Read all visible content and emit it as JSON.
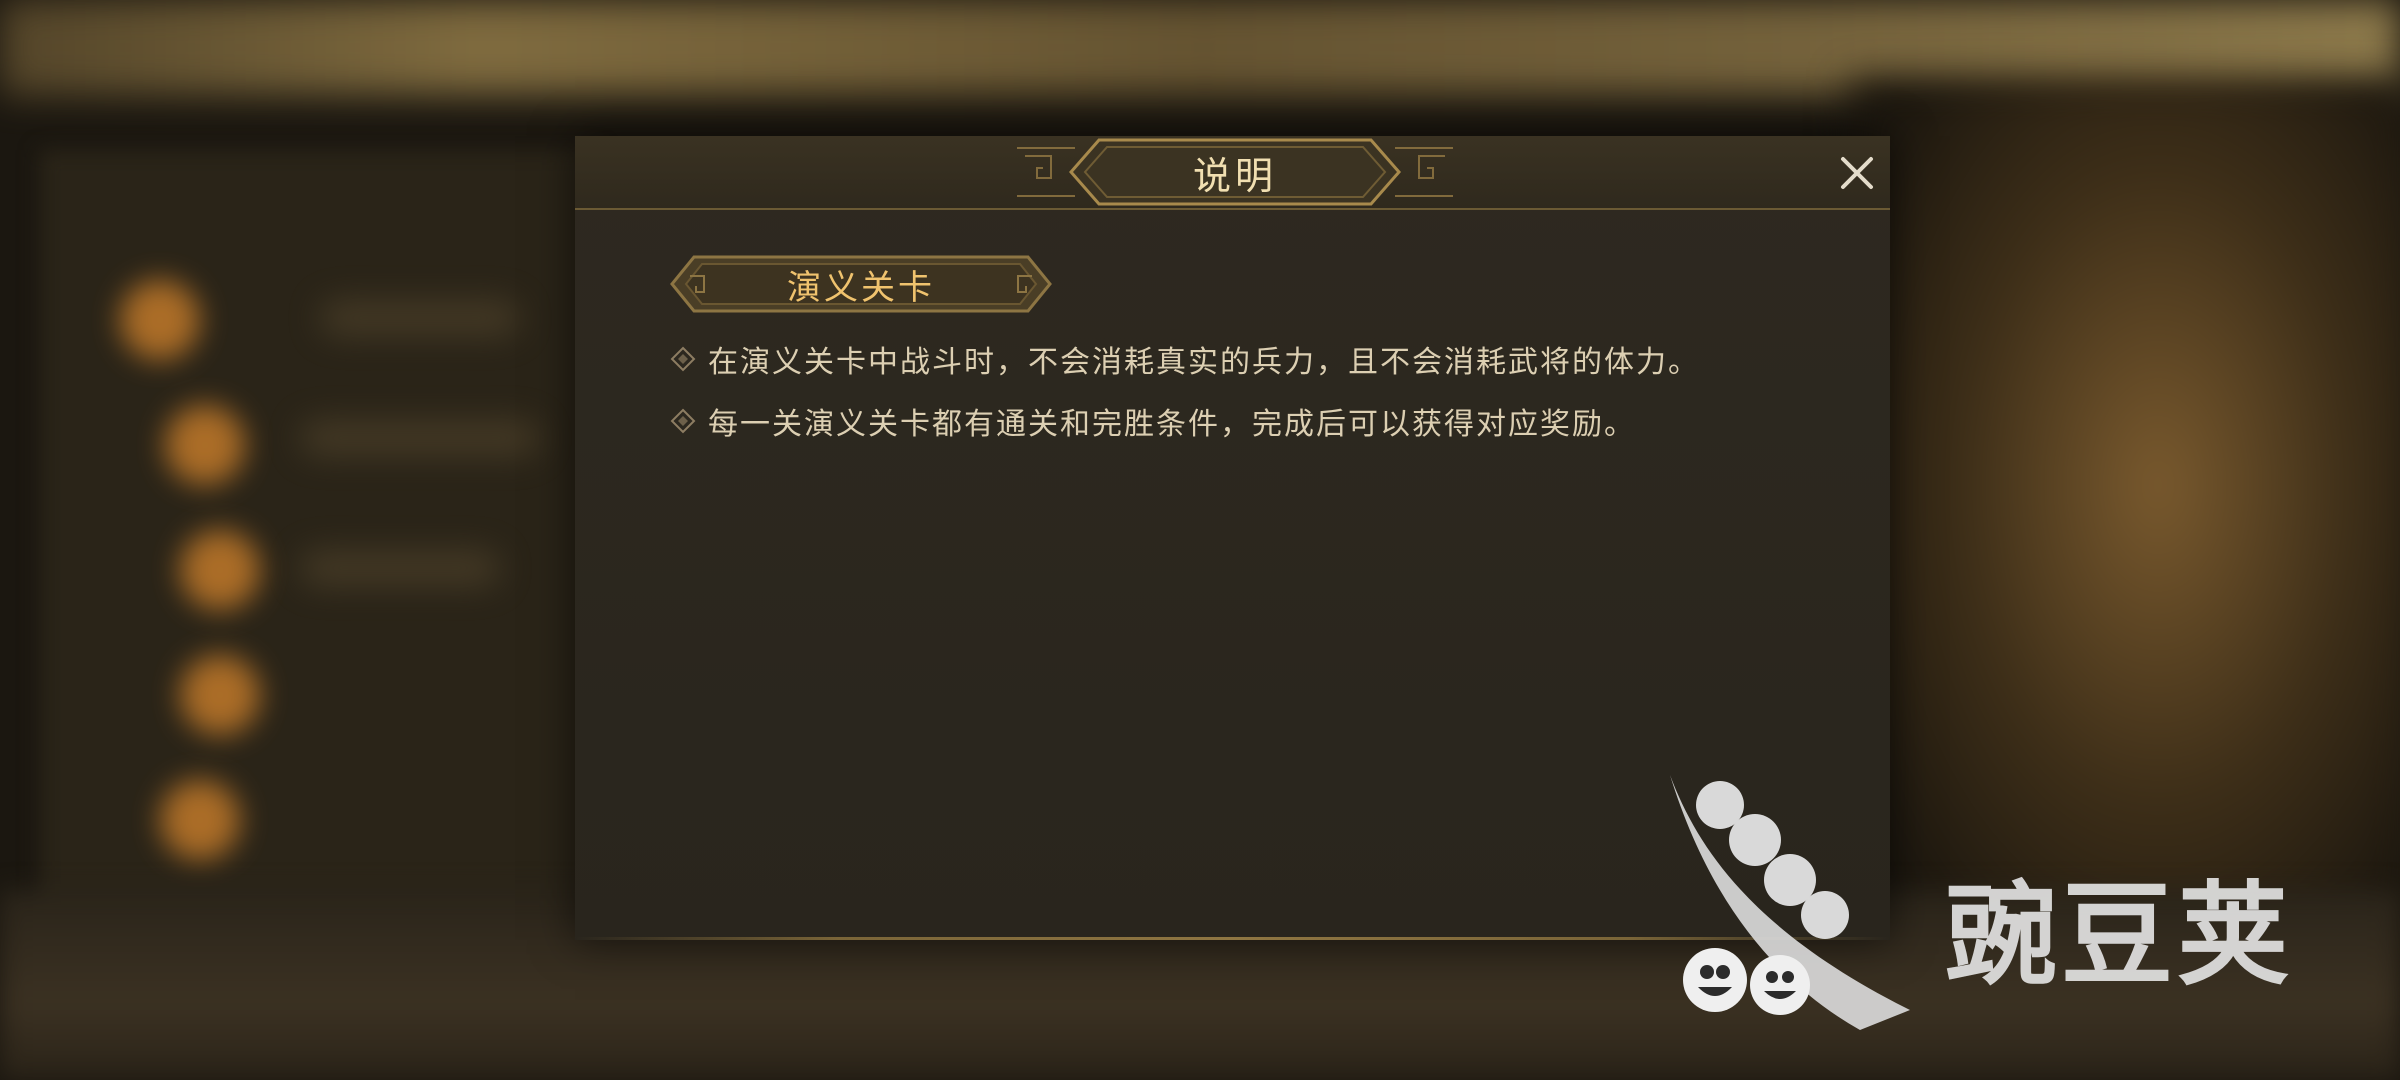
{
  "dialog": {
    "title": "说明",
    "close_icon": "close-icon"
  },
  "section": {
    "title": "演义关卡"
  },
  "rules": [
    "在演义关卡中战斗时，不会消耗真实的兵力，且不会消耗武将的体力。",
    "每一关演义关卡都有通关和完胜条件，完成后可以获得对应奖励。"
  ],
  "watermark": {
    "text": "豌豆荚",
    "logo_icon": "pea-pod-logo"
  },
  "colors": {
    "title_text": "#f1dfb1",
    "section_text": "#f0c36e",
    "body_text": "#dccfb2",
    "frame_gold": "#8f7642",
    "dialog_bg": "#29251d"
  }
}
